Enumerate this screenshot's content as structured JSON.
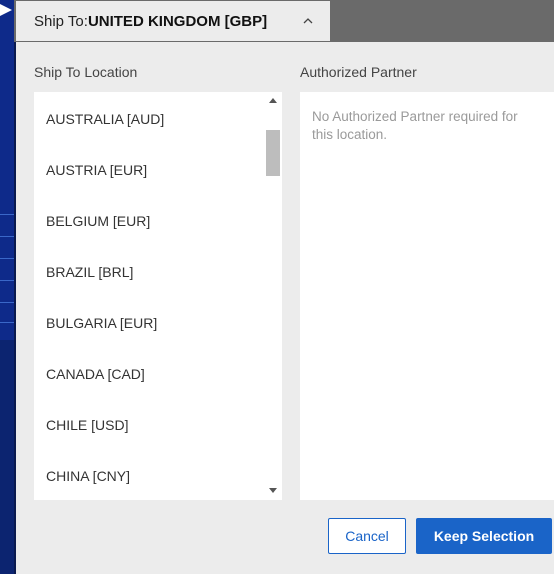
{
  "dropdown": {
    "label": "Ship To: ",
    "value": "UNITED KINGDOM [GBP]",
    "chevron_icon": "chevron-up-icon"
  },
  "ship_to": {
    "heading": "Ship To Location",
    "items": [
      {
        "label": "AUSTRALIA [AUD]"
      },
      {
        "label": "AUSTRIA [EUR]"
      },
      {
        "label": "BELGIUM [EUR]"
      },
      {
        "label": "BRAZIL [BRL]"
      },
      {
        "label": "BULGARIA [EUR]"
      },
      {
        "label": "CANADA [CAD]"
      },
      {
        "label": "CHILE [USD]"
      },
      {
        "label": "CHINA [CNY]"
      }
    ]
  },
  "partner": {
    "heading": "Authorized Partner",
    "note": "No Authorized Partner required for this location."
  },
  "actions": {
    "cancel_label": "Cancel",
    "keep_label": "Keep Selection"
  },
  "colors": {
    "accent": "#1a64c8",
    "panel_bg": "#ececec",
    "backdrop": "#0a1a4f"
  }
}
